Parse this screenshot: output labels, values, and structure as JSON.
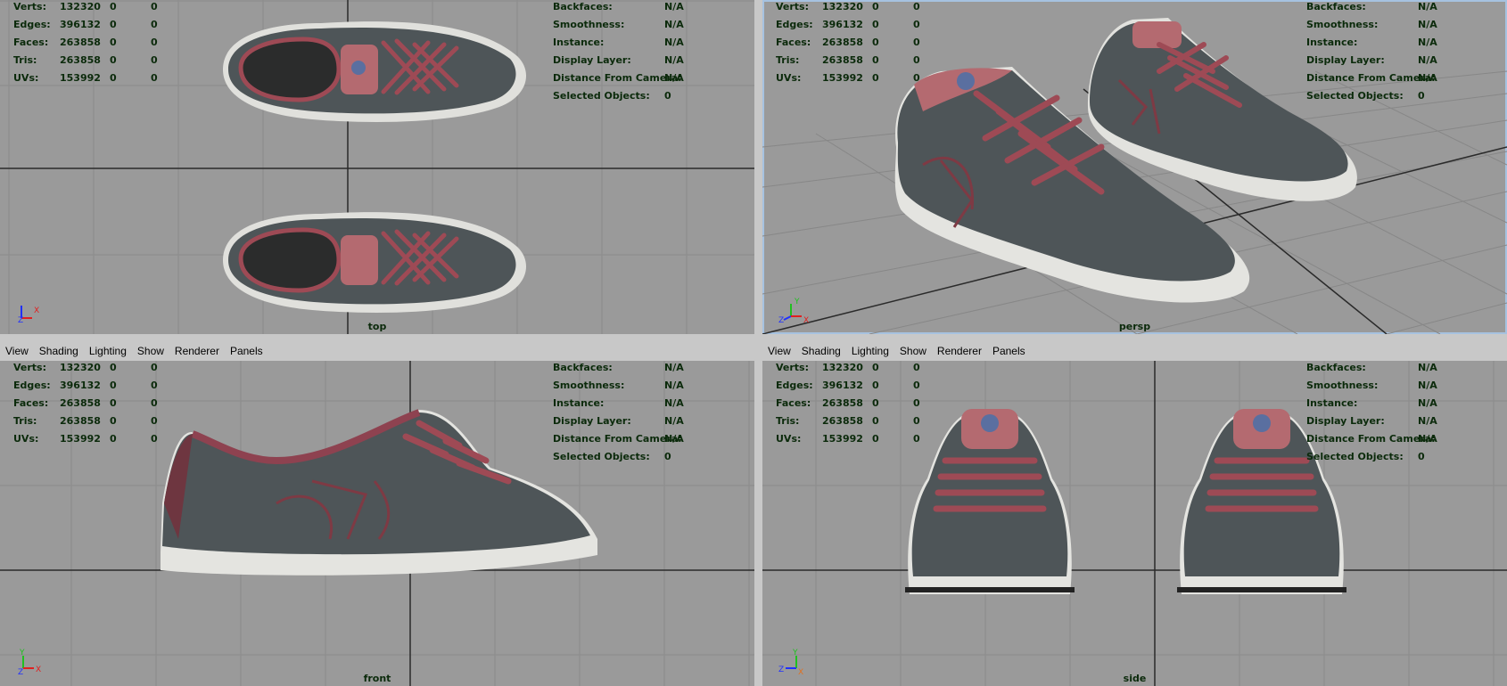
{
  "menu": [
    "View",
    "Shading",
    "Lighting",
    "Show",
    "Renderer",
    "Panels"
  ],
  "stats_left": [
    {
      "label": "Verts:",
      "v": "132320",
      "a": "0",
      "b": "0"
    },
    {
      "label": "Edges:",
      "v": "396132",
      "a": "0",
      "b": "0"
    },
    {
      "label": "Faces:",
      "v": "263858",
      "a": "0",
      "b": "0"
    },
    {
      "label": "Tris:",
      "v": "263858",
      "a": "0",
      "b": "0"
    },
    {
      "label": "UVs:",
      "v": "153992",
      "a": "0",
      "b": "0"
    }
  ],
  "stats_right": [
    {
      "label": "Backfaces:",
      "value": "N/A"
    },
    {
      "label": "Smoothness:",
      "value": "N/A"
    },
    {
      "label": "Instance:",
      "value": "N/A"
    },
    {
      "label": "Display Layer:",
      "value": "N/A"
    },
    {
      "label": "Distance From Camera:",
      "value": "N/A"
    },
    {
      "label": "Selected Objects:",
      "value": "0"
    }
  ],
  "panes": {
    "top": {
      "camera": "top"
    },
    "persp": {
      "camera": "persp"
    },
    "front": {
      "camera": "front"
    },
    "side": {
      "camera": "side"
    }
  },
  "axis_labels": {
    "x": "X",
    "y": "Y",
    "z": "Z"
  },
  "colors": {
    "viewport_bg": "#9a9a9a",
    "grid": "#8a8a8a",
    "hud_text": "#0b2a0b",
    "shoe_body": "#4e5558",
    "shoe_laces": "#9e4a55",
    "sole": "#e4e4e0",
    "active_border": "#a6c2e0"
  }
}
